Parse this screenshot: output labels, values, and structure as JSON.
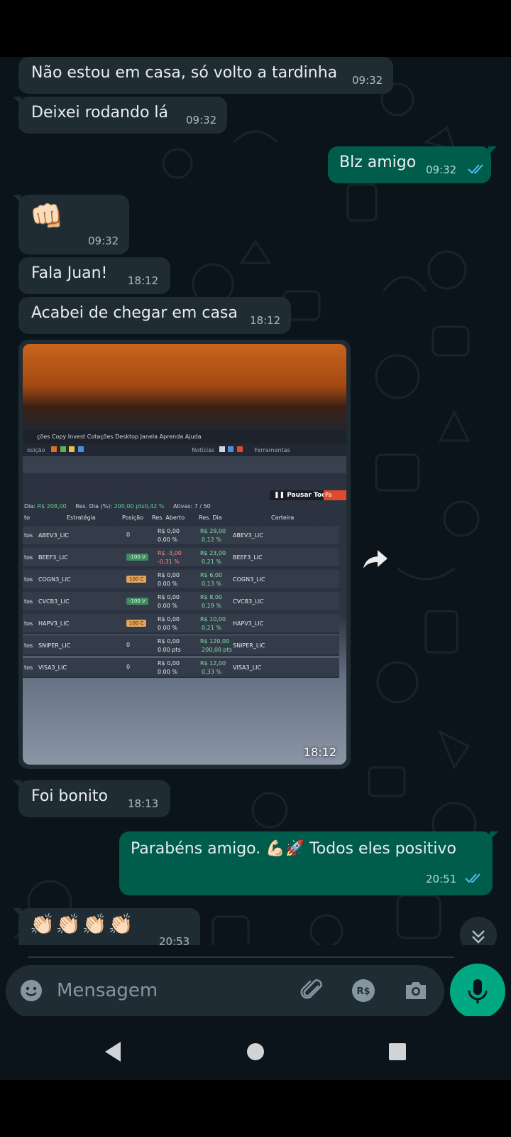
{
  "colors": {
    "background": "#0b141a",
    "incoming_bubble": "#202c33",
    "outgoing_bubble": "#005c4b",
    "accent": "#00a884",
    "read_ticks": "#53bdeb"
  },
  "messages": [
    {
      "text": "Não estou em casa, só volto a tardinha",
      "time": "09:32"
    },
    {
      "text": "Deixei rodando lá",
      "time": "09:32"
    },
    {
      "text": "Blz amigo",
      "time": "09:32"
    },
    {
      "text": "👊🏻",
      "time": "09:32"
    },
    {
      "text": "Fala Juan!",
      "time": "18:12"
    },
    {
      "text": "Acabei de chegar em casa",
      "time": "18:12"
    },
    {
      "text": "",
      "time": "18:12"
    },
    {
      "text": "Foi bonito",
      "time": "18:13"
    },
    {
      "text": "Parabéns amigo. 💪🏻🚀 Todos eles positivo",
      "time": "20:51"
    },
    {
      "text": "👏🏻👏🏻👏🏻👏🏻",
      "time": "20:53"
    }
  ],
  "photo": {
    "menu": "ções  Copy Invest  Cotações  Desktop  Janela  Aprenda  Ajuda",
    "toolbar_left": "osição",
    "toolbar_mid": "Notícias",
    "toolbar_right": "Ferramentas",
    "pause_label": "Pausar Todas",
    "red_label": "Pa",
    "stats": {
      "res_label": "Dia:",
      "res_value": "R$ 208,00",
      "res_pct_label": "Res. Dia (%):",
      "res_pct_value": "200,00 pts0,42 %",
      "ativas": "Ativas:  7 / 50"
    },
    "headers": {
      "col1": "to",
      "col2": "Estratégia",
      "col3": "Posição",
      "col4": "Res. Aberto",
      "col5": "Res. Dia",
      "col6": "Carteira"
    },
    "rows": [
      {
        "prefix": "tos",
        "strategy": "ABEV3_LIC",
        "position": "0",
        "open1": "R$ 0,00",
        "open2": "0.00 %",
        "day1": "R$ 29,00",
        "day2": "0,12 %",
        "wallet": "ABEV3_LIC"
      },
      {
        "prefix": "tos",
        "strategy": "BEEF3_LIC",
        "position": "-100 V",
        "open1": "R$ -3,00",
        "open2": "-0,31 %",
        "day1": "R$ 23,00",
        "day2": "0,21 %",
        "wallet": "BEEF3_LIC"
      },
      {
        "prefix": "tos",
        "strategy": "COGN3_LIC",
        "position": "100 C",
        "open1": "R$ 0,00",
        "open2": "0.00 %",
        "day1": "R$ 6,00",
        "day2": "0,13 %",
        "wallet": "COGN3_LIC"
      },
      {
        "prefix": "tos",
        "strategy": "CVCB3_LIC",
        "position": "-100 V",
        "open1": "R$ 0,00",
        "open2": "0.00 %",
        "day1": "R$ 8,00",
        "day2": "0,19 %",
        "wallet": "CVCB3_LIC"
      },
      {
        "prefix": "tos",
        "strategy": "HAPV3_LIC",
        "position": "100 C",
        "open1": "R$ 0,00",
        "open2": "0.00 %",
        "day1": "R$ 10,00",
        "day2": "0,21 %",
        "wallet": "HAPV3_LIC"
      },
      {
        "prefix": "tos",
        "strategy": "SNIPER_LIC",
        "position": "0",
        "open1": "R$ 0,00",
        "open2": "0.00 pts",
        "day1": "R$ 120,00",
        "day2": "200,00 pts",
        "wallet": "SNIPER_LIC"
      },
      {
        "prefix": "tos",
        "strategy": "VISA3_LIC",
        "position": "0",
        "open1": "R$ 0,00",
        "open2": "0.00 %",
        "day1": "R$ 12,00",
        "day2": "0,33 %",
        "wallet": "VISA3_LIC"
      }
    ]
  },
  "composer": {
    "placeholder": "Mensagem",
    "emoji_icon": "emoji-icon",
    "attach_icon": "paperclip-icon",
    "payment_icon": "rs-payment-icon",
    "camera_icon": "camera-icon",
    "mic_icon": "mic-icon"
  },
  "nav": {
    "back": "back-triangle-icon",
    "home": "home-circle-icon",
    "recents": "recents-square-icon"
  }
}
